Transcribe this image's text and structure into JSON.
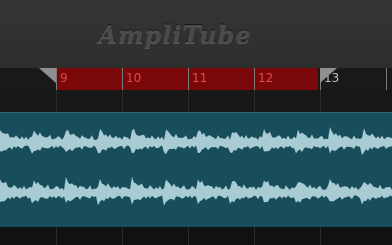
{
  "app": {
    "logo_text": "AmpliTube"
  },
  "timeline": {
    "bars": [
      "9",
      "10",
      "11",
      "12",
      "13"
    ],
    "loop_start_bar": "9",
    "loop_end_bar": "13"
  },
  "colors": {
    "loop_region": "#7a0808",
    "waveform": "#a9cbd3",
    "track_bg": "#184e5b"
  },
  "icons": {
    "loop_start": "loop-start-marker-icon",
    "loop_end": "loop-end-marker-icon"
  }
}
